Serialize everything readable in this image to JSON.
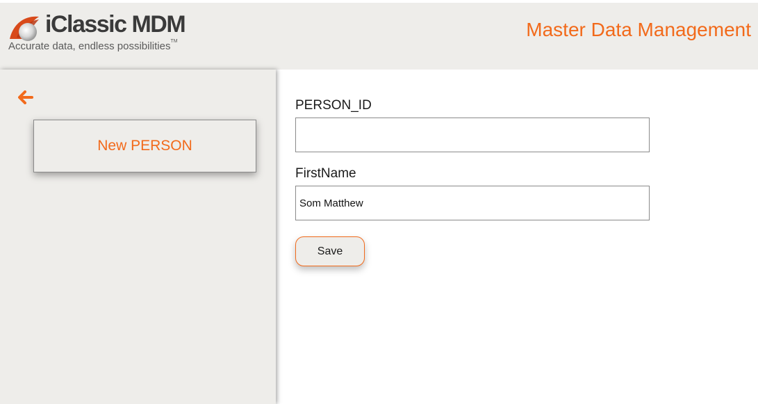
{
  "header": {
    "logo_title": "iClassic MDM",
    "logo_tagline": "Accurate data, endless possibilities",
    "logo_tm": "TM",
    "app_title": "Master Data Management"
  },
  "sidebar": {
    "back_icon": "arrow-left-icon",
    "new_button_label": "New PERSON"
  },
  "form": {
    "fields": [
      {
        "label": "PERSON_ID",
        "value": "",
        "placeholder": ""
      },
      {
        "label": "FirstName",
        "value": "Som Matthew",
        "placeholder": ""
      }
    ],
    "save_label": "Save"
  },
  "colors": {
    "accent": "#f26a1b",
    "panel": "#eeedea",
    "logo_mark": "#d84a1b"
  }
}
